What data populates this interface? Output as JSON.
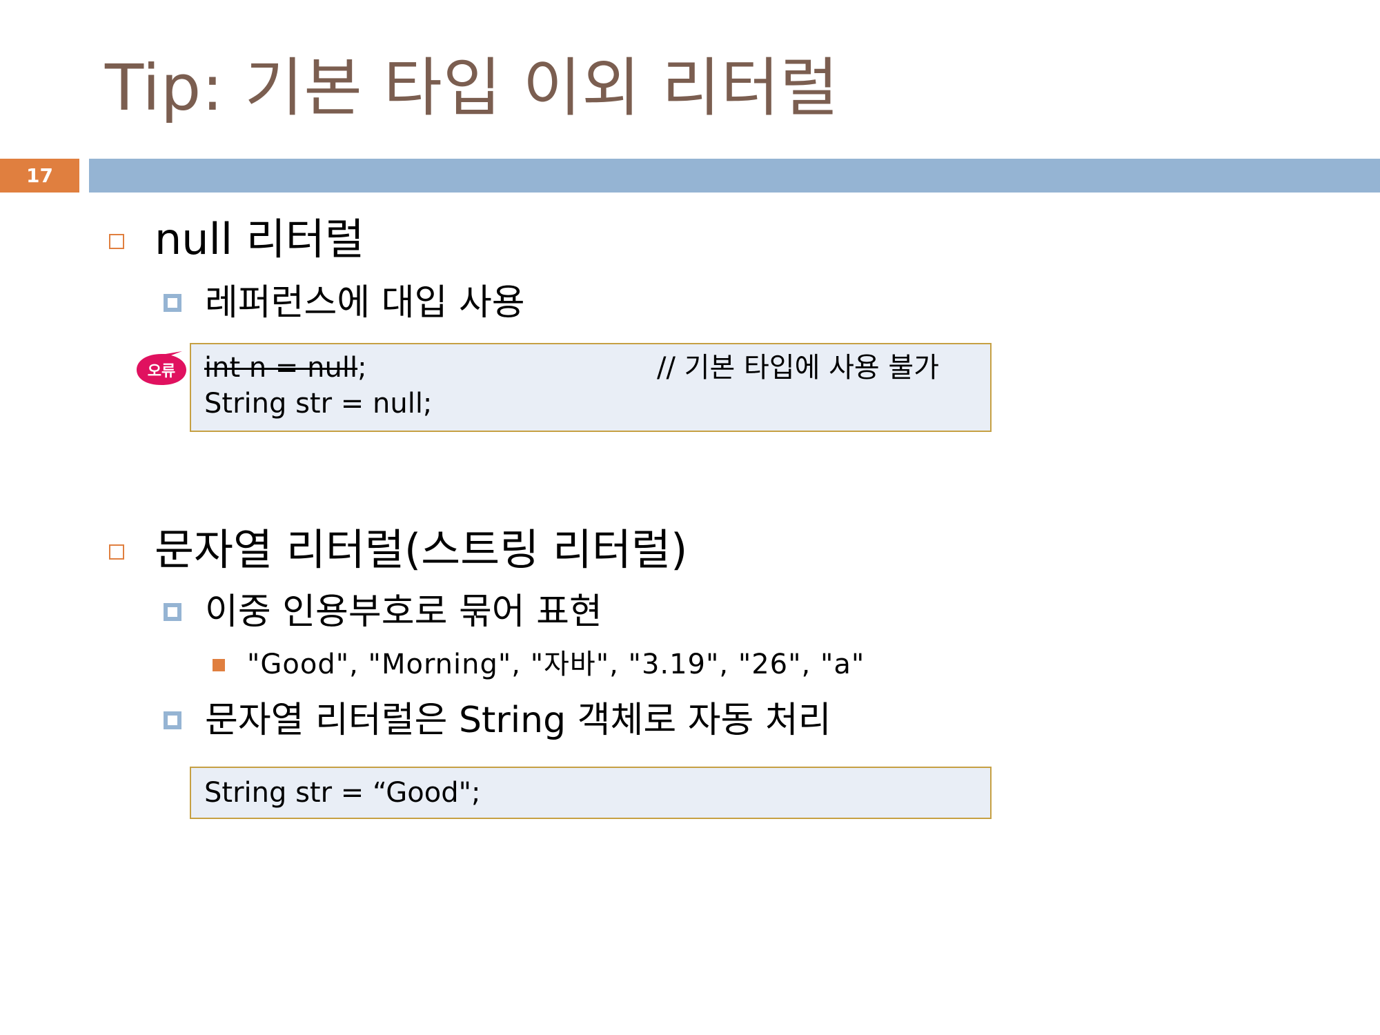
{
  "title": "Tip: 기본 타입 이외 리터럴",
  "page_number": "17",
  "section_null": {
    "heading": "null 리터럴",
    "point": "레퍼런스에 대입 사용",
    "error_badge": "오류",
    "code": {
      "line1_struck": "int n = null",
      "line1_end": ";",
      "line1_comment": "// 기본 타입에 사용 불가",
      "line2": "String str = null;"
    }
  },
  "section_string": {
    "heading": "문자열 리터럴(스트링 리터럴)",
    "point1": "이중 인용부호로 묶어 표현",
    "example": "\"Good\", \"Morning\", \"자바\", \"3.19\", \"26\", \"a\"",
    "point2": "문자열 리터럴은 String 객체로 자동 처리",
    "code": {
      "line1": "String str = “Good\";"
    }
  },
  "colors": {
    "title": "#7b5e50",
    "accent_orange": "#e07f3f",
    "bar_blue": "#95b4d3",
    "code_bg": "#e9eef6",
    "code_border": "#c6a043",
    "badge_red": "#e0115f"
  }
}
